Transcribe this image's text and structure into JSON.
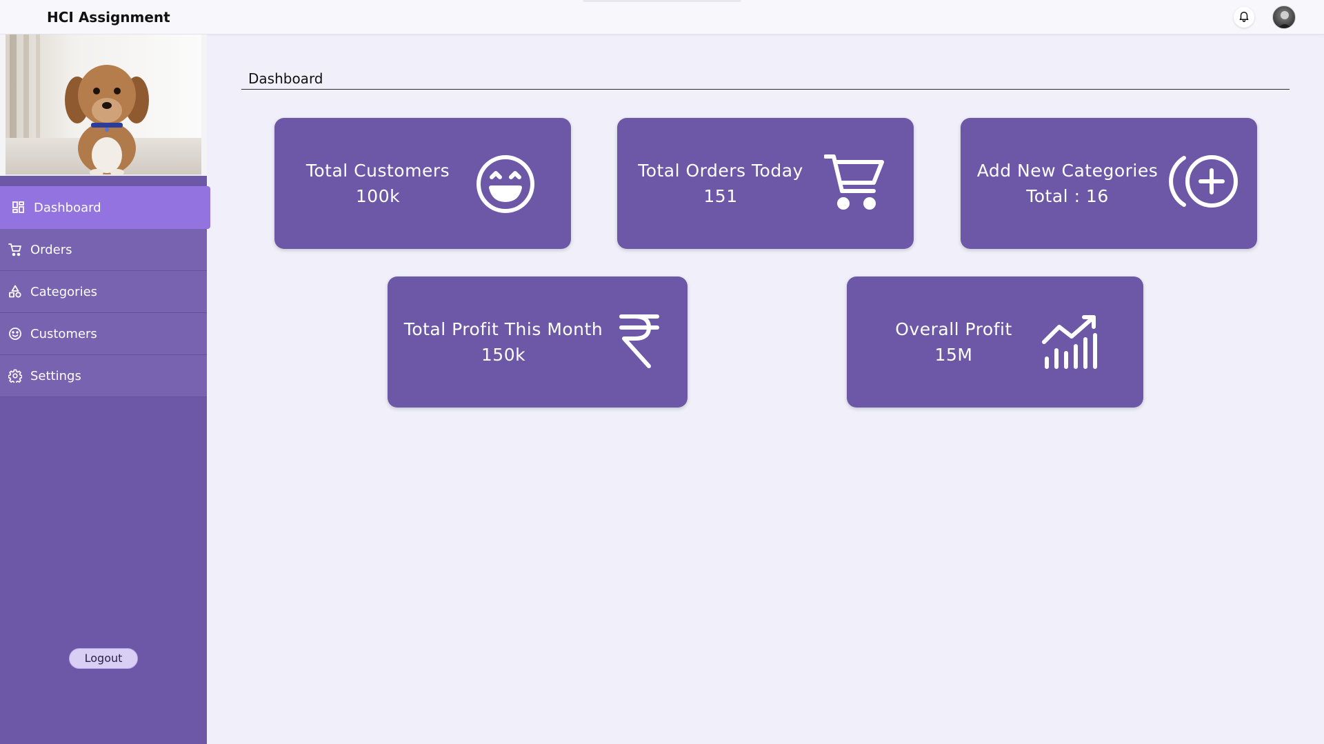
{
  "app": {
    "title": "HCI Assignment"
  },
  "header": {
    "bell_icon": "bell-icon",
    "avatar_icon": "user-avatar"
  },
  "sidebar": {
    "items": [
      {
        "label": "Dashboard",
        "icon": "grid-icon",
        "active": true
      },
      {
        "label": "Orders",
        "icon": "cart-icon",
        "active": false
      },
      {
        "label": "Categories",
        "icon": "shapes-icon",
        "active": false
      },
      {
        "label": "Customers",
        "icon": "smile-icon",
        "active": false
      },
      {
        "label": "Settings",
        "icon": "gear-icon",
        "active": false
      }
    ],
    "logout_label": "Logout"
  },
  "main": {
    "title": "Dashboard",
    "cards": [
      {
        "label": "Total Customers",
        "value": "100k",
        "icon": "grinning-face-icon"
      },
      {
        "label": "Total Orders Today",
        "value": "151",
        "icon": "shopping-cart-icon"
      },
      {
        "label": "Add New Categories",
        "value": "Total : 16",
        "icon": "add-circle-icon"
      },
      {
        "label": "Total Profit This Month",
        "value": "150k",
        "icon": "rupee-icon"
      },
      {
        "label": "Overall Profit",
        "value": "15M",
        "icon": "trending-chart-icon"
      }
    ]
  },
  "colors": {
    "accent": "#6c58a6",
    "active_nav": "#9273e0",
    "background": "#f1f0fa",
    "logout_button": "#d9cff5"
  }
}
